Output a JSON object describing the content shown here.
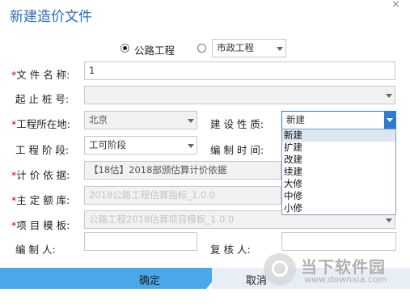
{
  "dialog": {
    "title": "新建造价文件",
    "close_glyph": "×"
  },
  "project_type": {
    "option_1": "公路工程",
    "option_2_selected": "市政工程"
  },
  "form": {
    "file_name": {
      "label": "文 件 名 称:",
      "value": "1"
    },
    "station": {
      "label": "起 止 桩 号:",
      "value": ""
    },
    "location": {
      "label": "工程所在地:",
      "value": "北京"
    },
    "construction_type": {
      "label": "建 设 性 质:",
      "value": "新建",
      "options": [
        "新建",
        "扩建",
        "改建",
        "续建",
        "大修",
        "中修",
        "小修"
      ]
    },
    "stage": {
      "label": "工 程 阶 段:",
      "value": "工可阶段"
    },
    "compile_time": {
      "label": "编 制 时 间:"
    },
    "pricing_basis": {
      "label": "计 价 依 据:",
      "value": "【18估】2018部颁估算计价依据"
    },
    "quota_library": {
      "label": "主 定 额 库:",
      "value": "2018公路工程估算指标_1.0.0"
    },
    "project_template": {
      "label": "项 目 模 板:",
      "value": "公路工程2018估算项目模板_1.0.0"
    },
    "compiler": {
      "label": "编  制  人:",
      "value": ""
    },
    "reviewer": {
      "label": "复  核  人:",
      "value": ""
    }
  },
  "footer": {
    "confirm": "确定",
    "cancel": "取消"
  },
  "watermark": {
    "text": "当下软件园",
    "url": "www.downxia.com"
  }
}
